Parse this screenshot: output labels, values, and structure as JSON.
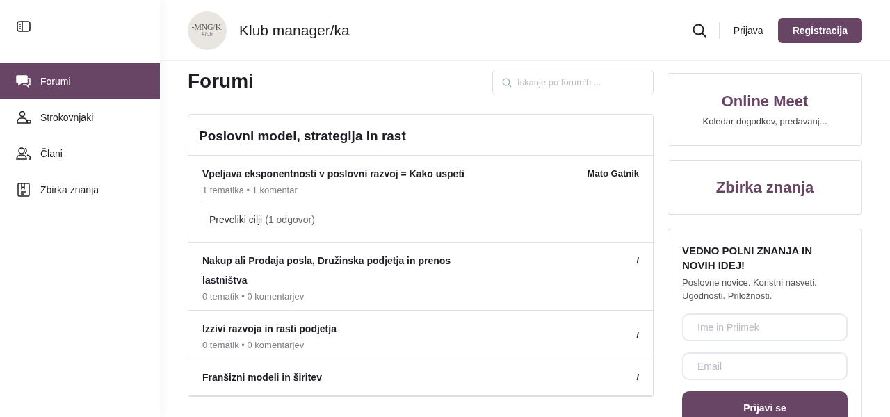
{
  "sidebar": {
    "items": [
      {
        "label": "Forumi",
        "selected": true
      },
      {
        "label": "Strokovnjaki",
        "selected": false
      },
      {
        "label": "Člani",
        "selected": false
      },
      {
        "label": "Zbirka znanja",
        "selected": false
      }
    ]
  },
  "header": {
    "logo": {
      "mark": "-MNG/K.",
      "script": "klub"
    },
    "title": "Klub manager/ka",
    "login": "Prijava",
    "register": "Registracija"
  },
  "main": {
    "title": "Forumi",
    "search": {
      "placeholder": "Iskanje po forumih ..."
    },
    "category": {
      "title": "Poslovni model, strategija in rast",
      "forums": [
        {
          "title": "Vpeljava eksponentnosti v poslovni razvoj = Kako uspeti",
          "meta": "1 tematika • 1 komentar",
          "last": "Mato Gatnik",
          "topics": [
            {
              "title": "Preveliki cilji",
              "replies": "(1 odgovor)"
            }
          ]
        },
        {
          "title": "Nakup ali Prodaja posla, Družinska podjetja in prenos lastništva",
          "meta": "0 tematik • 0 komentarjev",
          "last": "/"
        },
        {
          "title": "Izzivi razvoja in rasti podjetja",
          "meta": "0 tematik • 0 komentarjev",
          "last": "/"
        },
        {
          "title": "Franšizni modeli in širitev",
          "last": "/"
        }
      ]
    }
  },
  "aside": {
    "online_meet": {
      "title": "Online Meet",
      "subtitle": "Koledar dogodkov, predavanj..."
    },
    "knowledge": {
      "title": "Zbirka znanja"
    },
    "newsletter": {
      "title": "VEDNO POLNI ZNANJA IN NOVIH IDEJ!",
      "text": "Poslovne novice. Koristni nasveti. Ugodnosti. Priložnosti.",
      "name_placeholder": "Ime in Priimek",
      "email_placeholder": "Email",
      "button": "Prijavi se"
    }
  }
}
